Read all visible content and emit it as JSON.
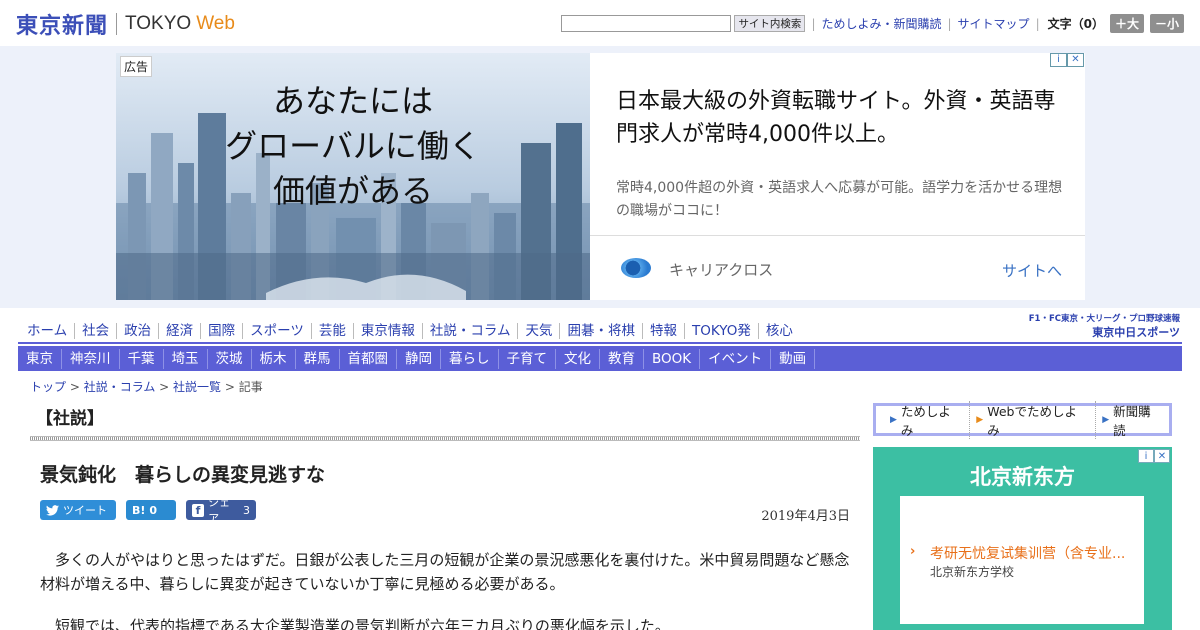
{
  "header": {
    "logo_jp": "東京新聞",
    "logo_en": "TOKYO",
    "logo_web": "Web",
    "search_button": "サイト内検索",
    "links": [
      "ためしよみ・新聞購読",
      "サイトマップ"
    ],
    "font_size_label": "文字（0）",
    "size_up": "＋大",
    "size_down": "－小"
  },
  "ad_banner": {
    "label": "広告",
    "headline_lines": [
      "あなたには",
      "グローバルに働く",
      "価値がある"
    ],
    "title": "日本最大級の外資転職サイト。外資・英語専門求人が常時4,000件以上。",
    "description": "常時4,000件超の外資・英語求人へ応募が可能。語学力を活かせる理想の職場がココに！",
    "advertiser": "キャリアクロス",
    "cta": "サイトへ"
  },
  "nav_primary": [
    "ホーム",
    "社会",
    "政治",
    "経済",
    "国際",
    "スポーツ",
    "芸能",
    "東京情報",
    "社説・コラム",
    "天気",
    "囲碁・将棋",
    "特報",
    "TOKYO発",
    "核心"
  ],
  "nav_secondary": [
    "東京",
    "神奈川",
    "千葉",
    "埼玉",
    "茨城",
    "栃木",
    "群馬",
    "首都圏",
    "静岡",
    "暮らし",
    "子育て",
    "文化",
    "教育",
    "BOOK",
    "イベント",
    "動画"
  ],
  "chunichi": {
    "top": "F1・FC東京・大リーグ・プロ野球速報",
    "bottom": "東京中日スポーツ"
  },
  "breadcrumb": {
    "items": [
      "トップ",
      "社説・コラム",
      "社説一覧"
    ],
    "current": "記事"
  },
  "article": {
    "section": "【社説】",
    "title": "景気鈍化　暮らしの異変見逃すな",
    "share": {
      "tweet": "ツイート",
      "hatena": "B!",
      "hatena_count": "0",
      "facebook": "シェア",
      "facebook_count": "3"
    },
    "date": "2019年4月3日",
    "paragraphs": [
      "多くの人がやはりと思ったはずだ。日銀が公表した三月の短観が企業の景況感悪化を裏付けた。米中貿易問題など懸念材料が増える中、暮らしに異変が起きていないか丁寧に見極める必要がある。",
      "短観では、代表的指標である大企業製造業の景気判断が六年三カ月ぶりの悪化幅を示した。"
    ]
  },
  "sidebar": {
    "links": [
      "ためしよみ",
      "Webでためしよみ",
      "新聞購読"
    ],
    "ad": {
      "title": "北京新东方",
      "text": "考研无忧复试集训营（含专业...",
      "sub": "北京新东方学校"
    }
  }
}
